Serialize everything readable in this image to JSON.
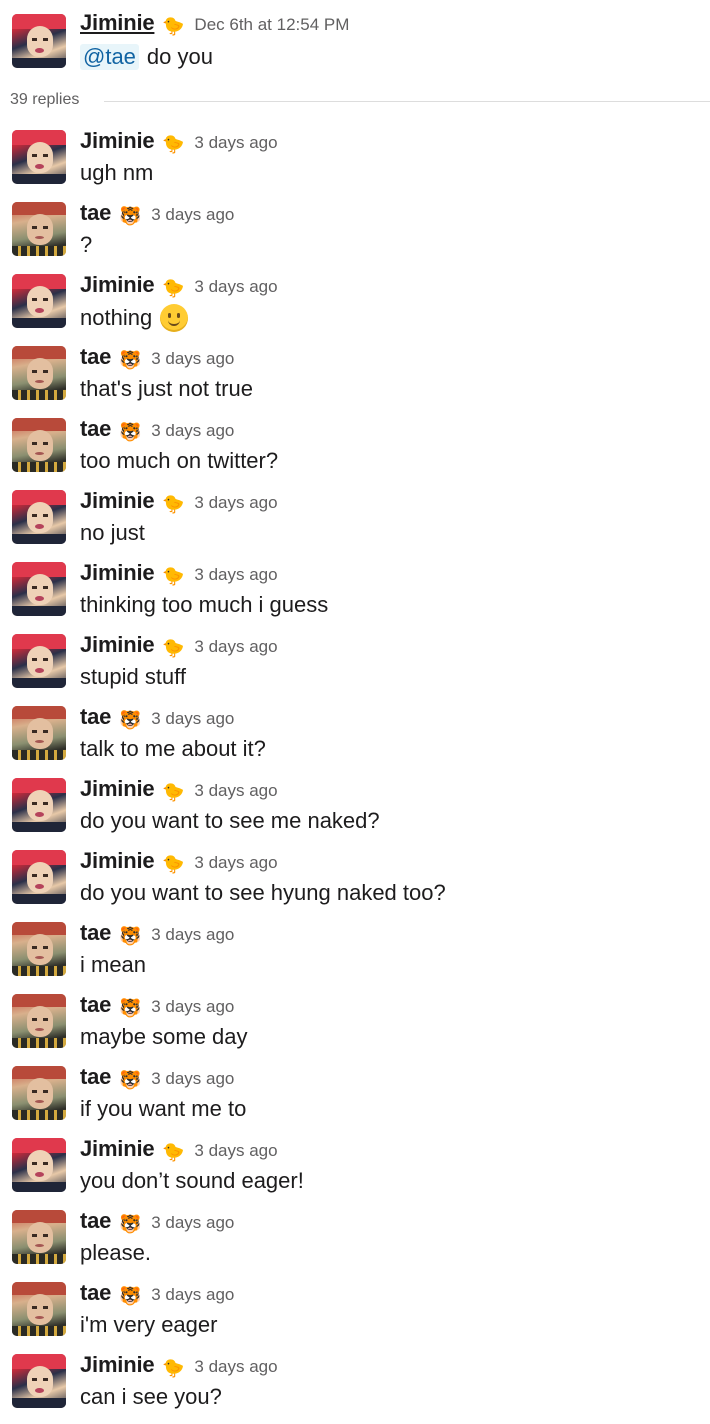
{
  "parent": {
    "author": "Jiminie",
    "emoji": "🐤",
    "avatar": "jimin",
    "time": "Dec 6th at 12:54 PM",
    "mention": "@tae",
    "text": "do you"
  },
  "replies_label": "39 replies",
  "messages": [
    {
      "author": "Jiminie",
      "emoji": "🐤",
      "avatar": "jimin",
      "time": "3 days ago",
      "text": "ugh nm"
    },
    {
      "author": "tae",
      "emoji": "🐯",
      "avatar": "tae",
      "time": "3 days ago",
      "text": "?"
    },
    {
      "author": "Jiminie",
      "emoji": "🐤",
      "avatar": "jimin",
      "time": "3 days ago",
      "text": "nothing",
      "text_emoji": "slightly-smiling-face"
    },
    {
      "author": "tae",
      "emoji": "🐯",
      "avatar": "tae",
      "time": "3 days ago",
      "text": "that's just not true"
    },
    {
      "author": "tae",
      "emoji": "🐯",
      "avatar": "tae",
      "time": "3 days ago",
      "text": "too much on twitter?"
    },
    {
      "author": "Jiminie",
      "emoji": "🐤",
      "avatar": "jimin",
      "time": "3 days ago",
      "text": "no just"
    },
    {
      "author": "Jiminie",
      "emoji": "🐤",
      "avatar": "jimin",
      "time": "3 days ago",
      "text": "thinking too much i guess"
    },
    {
      "author": "Jiminie",
      "emoji": "🐤",
      "avatar": "jimin",
      "time": "3 days ago",
      "text": "stupid stuff"
    },
    {
      "author": "tae",
      "emoji": "🐯",
      "avatar": "tae",
      "time": "3 days ago",
      "text": "talk to me about it?"
    },
    {
      "author": "Jiminie",
      "emoji": "🐤",
      "avatar": "jimin",
      "time": "3 days ago",
      "text": "do you want to see me naked?"
    },
    {
      "author": "Jiminie",
      "emoji": "🐤",
      "avatar": "jimin",
      "time": "3 days ago",
      "text": "do you want to see hyung naked too?"
    },
    {
      "author": "tae",
      "emoji": "🐯",
      "avatar": "tae",
      "time": "3 days ago",
      "text": "i mean"
    },
    {
      "author": "tae",
      "emoji": "🐯",
      "avatar": "tae",
      "time": "3 days ago",
      "text": "maybe some day"
    },
    {
      "author": "tae",
      "emoji": "🐯",
      "avatar": "tae",
      "time": "3 days ago",
      "text": "if you want me to"
    },
    {
      "author": "Jiminie",
      "emoji": "🐤",
      "avatar": "jimin",
      "time": "3 days ago",
      "text": "you don’t sound eager!"
    },
    {
      "author": "tae",
      "emoji": "🐯",
      "avatar": "tae",
      "time": "3 days ago",
      "text": "please."
    },
    {
      "author": "tae",
      "emoji": "🐯",
      "avatar": "tae",
      "time": "3 days ago",
      "text": "i'm very eager"
    },
    {
      "author": "Jiminie",
      "emoji": "🐤",
      "avatar": "jimin",
      "time": "3 days ago",
      "text": "can i see you?"
    }
  ]
}
